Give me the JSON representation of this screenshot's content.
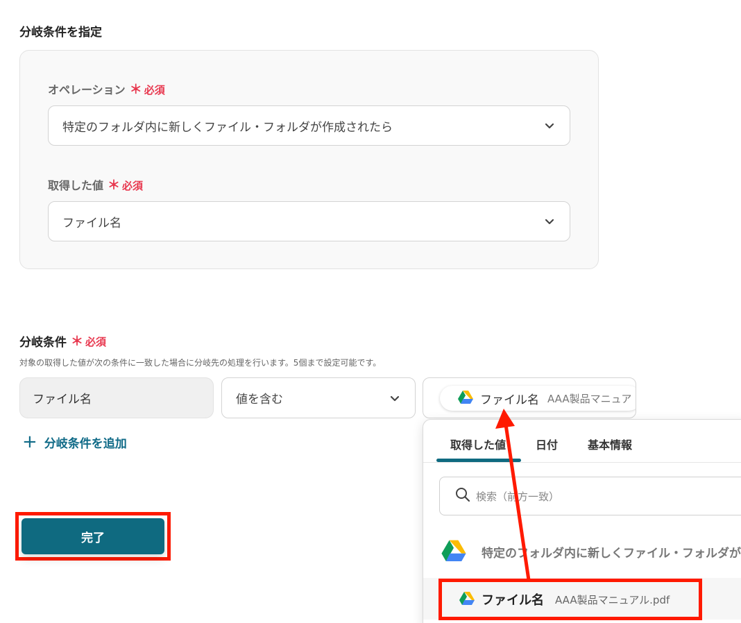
{
  "section_title": "分岐条件を指定",
  "required_label": "必須",
  "required_star": "＊",
  "operation": {
    "label": "オペレーション",
    "value": "特定のフォルダ内に新しくファイル・フォルダが作成されたら"
  },
  "acquired_value": {
    "label": "取得した値",
    "value": "ファイル名"
  },
  "condition": {
    "label": "分岐条件",
    "help": "対象の取得した値が次の条件に一致した場合に分岐先の処理を行います。5個まで設定可能です。",
    "field": "ファイル名",
    "operator": "値を含む",
    "value_chip": {
      "name": "ファイル名",
      "sub": "AAA製品マニュア"
    },
    "add_label": "分岐条件を追加",
    "add_icon": "+"
  },
  "done_button": "完了",
  "dropdown": {
    "tabs": [
      "取得した値",
      "日付",
      "基本情報"
    ],
    "active_tab": 0,
    "search_placeholder": "検索（前方一致）",
    "group_label": "特定のフォルダ内に新しくファイル・フォルダが作",
    "item": {
      "name": "ファイル名",
      "sub": "AAA製品マニュアル.pdf"
    }
  },
  "colors": {
    "accent": "#0f6a80",
    "required": "#e8384f",
    "annotation": "#ff1a00"
  },
  "icons": {
    "drive": "google-drive-icon",
    "chevron": "chevron-down-icon",
    "search": "search-icon",
    "plus": "plus-icon"
  }
}
